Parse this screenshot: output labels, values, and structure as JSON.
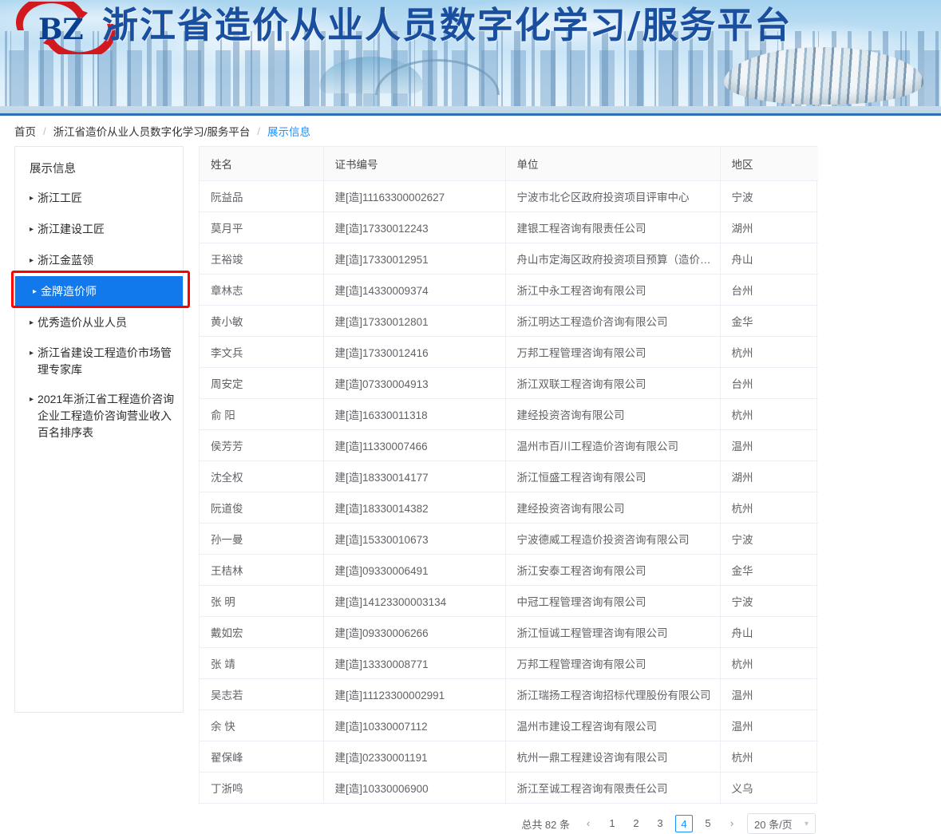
{
  "banner": {
    "logo_text": "BZ",
    "title": "浙江省造价从业人员数字化学习/服务平台"
  },
  "breadcrumb": {
    "items": [
      {
        "label": "首页",
        "active": false
      },
      {
        "label": "浙江省造价从业人员数字化学习/服务平台",
        "active": false
      },
      {
        "label": "展示信息",
        "active": true
      }
    ],
    "separator": "/"
  },
  "sidebar": {
    "title": "展示信息",
    "caret_icon": "chevron-right-icon",
    "items": [
      {
        "label": "浙江工匠",
        "active": false
      },
      {
        "label": "浙江建设工匠",
        "active": false
      },
      {
        "label": "浙江金蓝领",
        "active": false
      },
      {
        "label": "金牌造价师",
        "active": true
      },
      {
        "label": "优秀造价从业人员",
        "active": false
      },
      {
        "label": "浙江省建设工程造价市场管理专家库",
        "active": false
      },
      {
        "label": "2021年浙江省工程造价咨询企业工程造价咨询营业收入百名排序表",
        "active": false
      }
    ],
    "annotation_color": "#fe0000",
    "active_color": "#1179ec"
  },
  "table": {
    "columns": [
      "姓名",
      "证书编号",
      "单位",
      "地区"
    ],
    "rows": [
      [
        "阮益品",
        "建[造]11163300002627",
        "宁波市北仑区政府投资项目评审中心",
        "宁波"
      ],
      [
        "莫月平",
        "建[造]17330012243",
        "建银工程咨询有限责任公司",
        "湖州"
      ],
      [
        "王裕竣",
        "建[造]17330012951",
        "舟山市定海区政府投资项目预算（造价）编审...",
        "舟山"
      ],
      [
        "章林志",
        "建[造]14330009374",
        "浙江中永工程咨询有限公司",
        "台州"
      ],
      [
        "黄小敏",
        "建[造]17330012801",
        "浙江明达工程造价咨询有限公司",
        "金华"
      ],
      [
        "李文兵",
        "建[造]17330012416",
        "万邦工程管理咨询有限公司",
        "杭州"
      ],
      [
        "周安定",
        "建[造]07330004913",
        "浙江双联工程咨询有限公司",
        "台州"
      ],
      [
        "俞 阳",
        "建[造]16330011318",
        "建经投资咨询有限公司",
        "杭州"
      ],
      [
        "侯芳芳",
        "建[造]11330007466",
        "温州市百川工程造价咨询有限公司",
        "温州"
      ],
      [
        "沈全权",
        "建[造]18330014177",
        "浙江恒盛工程咨询有限公司",
        "湖州"
      ],
      [
        "阮道俊",
        "建[造]18330014382",
        "建经投资咨询有限公司",
        "杭州"
      ],
      [
        "孙一曼",
        "建[造]15330010673",
        "宁波德威工程造价投资咨询有限公司",
        "宁波"
      ],
      [
        "王桔林",
        "建[造]09330006491",
        "浙江安泰工程咨询有限公司",
        "金华"
      ],
      [
        "张 明",
        "建[造]14123300003134",
        "中冠工程管理咨询有限公司",
        "宁波"
      ],
      [
        "戴如宏",
        "建[造]09330006266",
        "浙江恒诚工程管理咨询有限公司",
        "舟山"
      ],
      [
        "张 靖",
        "建[造]13330008771",
        "万邦工程管理咨询有限公司",
        "杭州"
      ],
      [
        "吴志若",
        "建[造]11123300002991",
        "浙江瑞扬工程咨询招标代理股份有限公司",
        "温州"
      ],
      [
        "余 快",
        "建[造]10330007112",
        "温州市建设工程咨询有限公司",
        "温州"
      ],
      [
        "翟保峰",
        "建[造]02330001191",
        "杭州一鼎工程建设咨询有限公司",
        "杭州"
      ],
      [
        "丁浙鸣",
        "建[造]10330006900",
        "浙江至诚工程咨询有限责任公司",
        "义乌"
      ]
    ]
  },
  "pagination": {
    "total_label": "总共 82 条",
    "prev_icon": "chevron-left-icon",
    "next_icon": "chevron-right-icon",
    "prev_glyph": "‹",
    "next_glyph": "›",
    "pages": [
      "1",
      "2",
      "3",
      "4",
      "5"
    ],
    "current_page": "4",
    "page_size_label": "20 条/页",
    "page_size_chevron": "⌄"
  }
}
